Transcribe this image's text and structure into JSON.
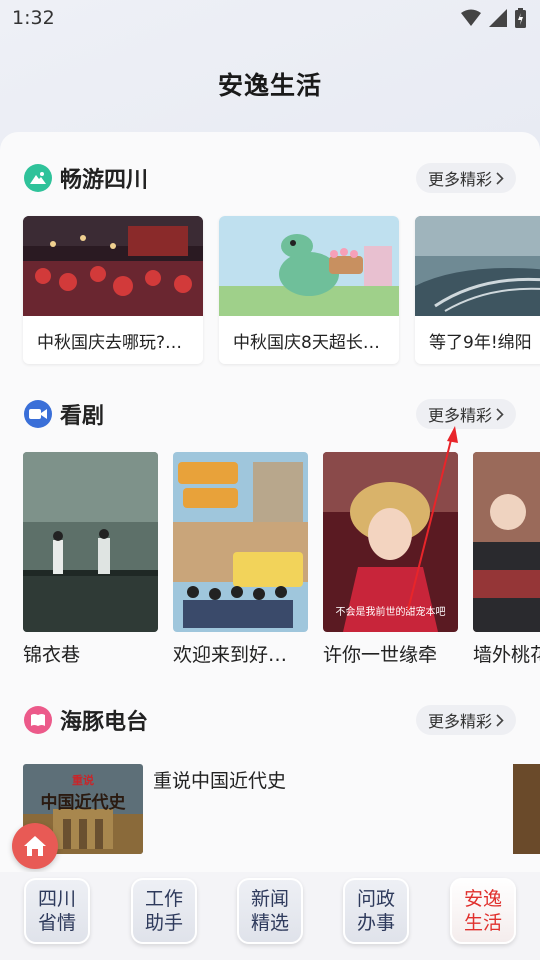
{
  "status": {
    "time": "1:32"
  },
  "app_title": "安逸生活",
  "sections": {
    "travel": {
      "title": "畅游四川",
      "more_label": "更多精彩",
      "items": [
        {
          "text": "中秋国庆去哪玩?…"
        },
        {
          "text": "中秋国庆8天超长…"
        },
        {
          "text": "等了9年!绵阳"
        }
      ]
    },
    "drama": {
      "title": "看剧",
      "more_label": "更多精彩",
      "items": [
        {
          "title": "锦衣巷"
        },
        {
          "title": "欢迎来到好…"
        },
        {
          "title": "许你一世缘牵",
          "poster_caption": "不会是我前世的甜宠本吧"
        },
        {
          "title": "墙外桃花"
        }
      ]
    },
    "radio": {
      "title": "海豚电台",
      "more_label": "更多精彩",
      "items": [
        {
          "title": "重说中国近代史",
          "cover_text": "中国近代史",
          "cover_badge": "重说"
        }
      ]
    }
  },
  "bottom_tabs": [
    {
      "line1": "四川",
      "line2": "省情",
      "active": false
    },
    {
      "line1": "工作",
      "line2": "助手",
      "active": false
    },
    {
      "line1": "新闻",
      "line2": "精选",
      "active": false
    },
    {
      "line1": "问政",
      "line2": "办事",
      "active": false
    },
    {
      "line1": "安逸",
      "line2": "生活",
      "active": true
    }
  ],
  "colors": {
    "accent_red": "#e0302d",
    "travel_icon": "#2fc29a",
    "drama_icon": "#3a6fd8",
    "radio_icon": "#ec5a8a"
  }
}
